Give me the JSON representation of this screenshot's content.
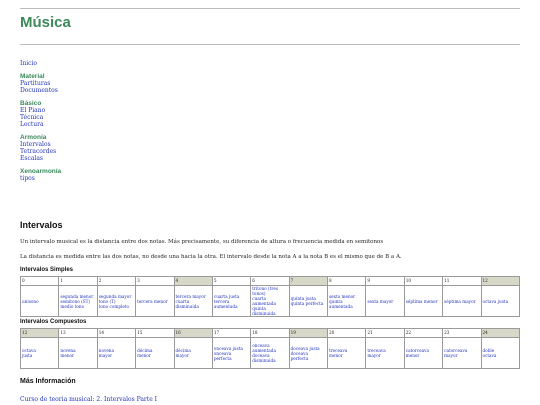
{
  "site": {
    "title": "Música"
  },
  "nav": {
    "home": "Inicio",
    "groups": [
      {
        "title": "Material",
        "items": [
          "Partituras",
          "Documentos"
        ]
      },
      {
        "title": "Básico",
        "items": [
          "El Piano",
          "Técnica",
          "Lectura"
        ]
      },
      {
        "title": "Armonía",
        "items": [
          "Intervalos",
          "Tetracordes",
          "Escalas"
        ]
      },
      {
        "title": "Xenoarmonía",
        "items": [
          "tipos"
        ]
      }
    ]
  },
  "article": {
    "title": "Intervalos",
    "para1": "Un intervalo musical es la distancia entre dos notas. Más precisamente, su diferencia de altura o frecuencia medida en semitonos",
    "para2": "La distancia es medida entre las dos notas, no desde una hacia la otra. El intervalo desde la nota A a la nota B es el mismo que de B a A."
  },
  "simple": {
    "title": "Intervalos Simples",
    "numbers": [
      "0",
      "1",
      "2",
      "3",
      "4",
      "5",
      "6",
      "7",
      "8",
      "9",
      "10",
      "11",
      "12"
    ],
    "highlighted": [
      4,
      7,
      12
    ],
    "names": [
      [
        "unisono"
      ],
      [
        "segunda menor",
        "semitono (ST)",
        "medio tono"
      ],
      [
        "segunda mayor",
        "tono (T)",
        "tono completo"
      ],
      [
        "tercera menor"
      ],
      [
        "tercera mayor",
        "cuarta disminuida"
      ],
      [
        "cuarta justa",
        "tercera aumentada"
      ],
      [
        "tritono (tres tonos)",
        "cuarta aumentada",
        "quinta disminuida"
      ],
      [
        "quinta justa",
        "quinta perfecta"
      ],
      [
        "sexta menor",
        "quinta aumentada"
      ],
      [
        "sexta mayor"
      ],
      [
        "séptima menor"
      ],
      [
        "séptima mayor"
      ],
      [
        "octava justa"
      ]
    ]
  },
  "compound": {
    "title": "Intervalos Compuestos",
    "numbers": [
      "12",
      "13",
      "14",
      "15",
      "16",
      "17",
      "18",
      "19",
      "20",
      "21",
      "22",
      "23",
      "24"
    ],
    "highlighted": [
      0,
      4,
      7,
      12
    ],
    "names": [
      [
        "octava",
        "justa"
      ],
      [
        "novena",
        "menor"
      ],
      [
        "novena",
        "mayor"
      ],
      [
        "décima",
        "menor"
      ],
      [
        "décima",
        "mayor"
      ],
      [
        "onceava justa",
        "onceava",
        "perfecta"
      ],
      [
        "onceava",
        "aumentada",
        "doceava",
        "disminuida"
      ],
      [
        "doceava justa",
        "doceava",
        "perfecta"
      ],
      [
        "treceava",
        "menor"
      ],
      [
        "treceava",
        "mayor"
      ],
      [
        "catorceava",
        "menor"
      ],
      [
        "catorceava",
        "mayor"
      ],
      [
        "doble",
        "octava"
      ]
    ]
  },
  "more": {
    "title": "Más Información",
    "links": [
      "Curso de teoria musical: 2. Intervalos Parte I"
    ]
  }
}
